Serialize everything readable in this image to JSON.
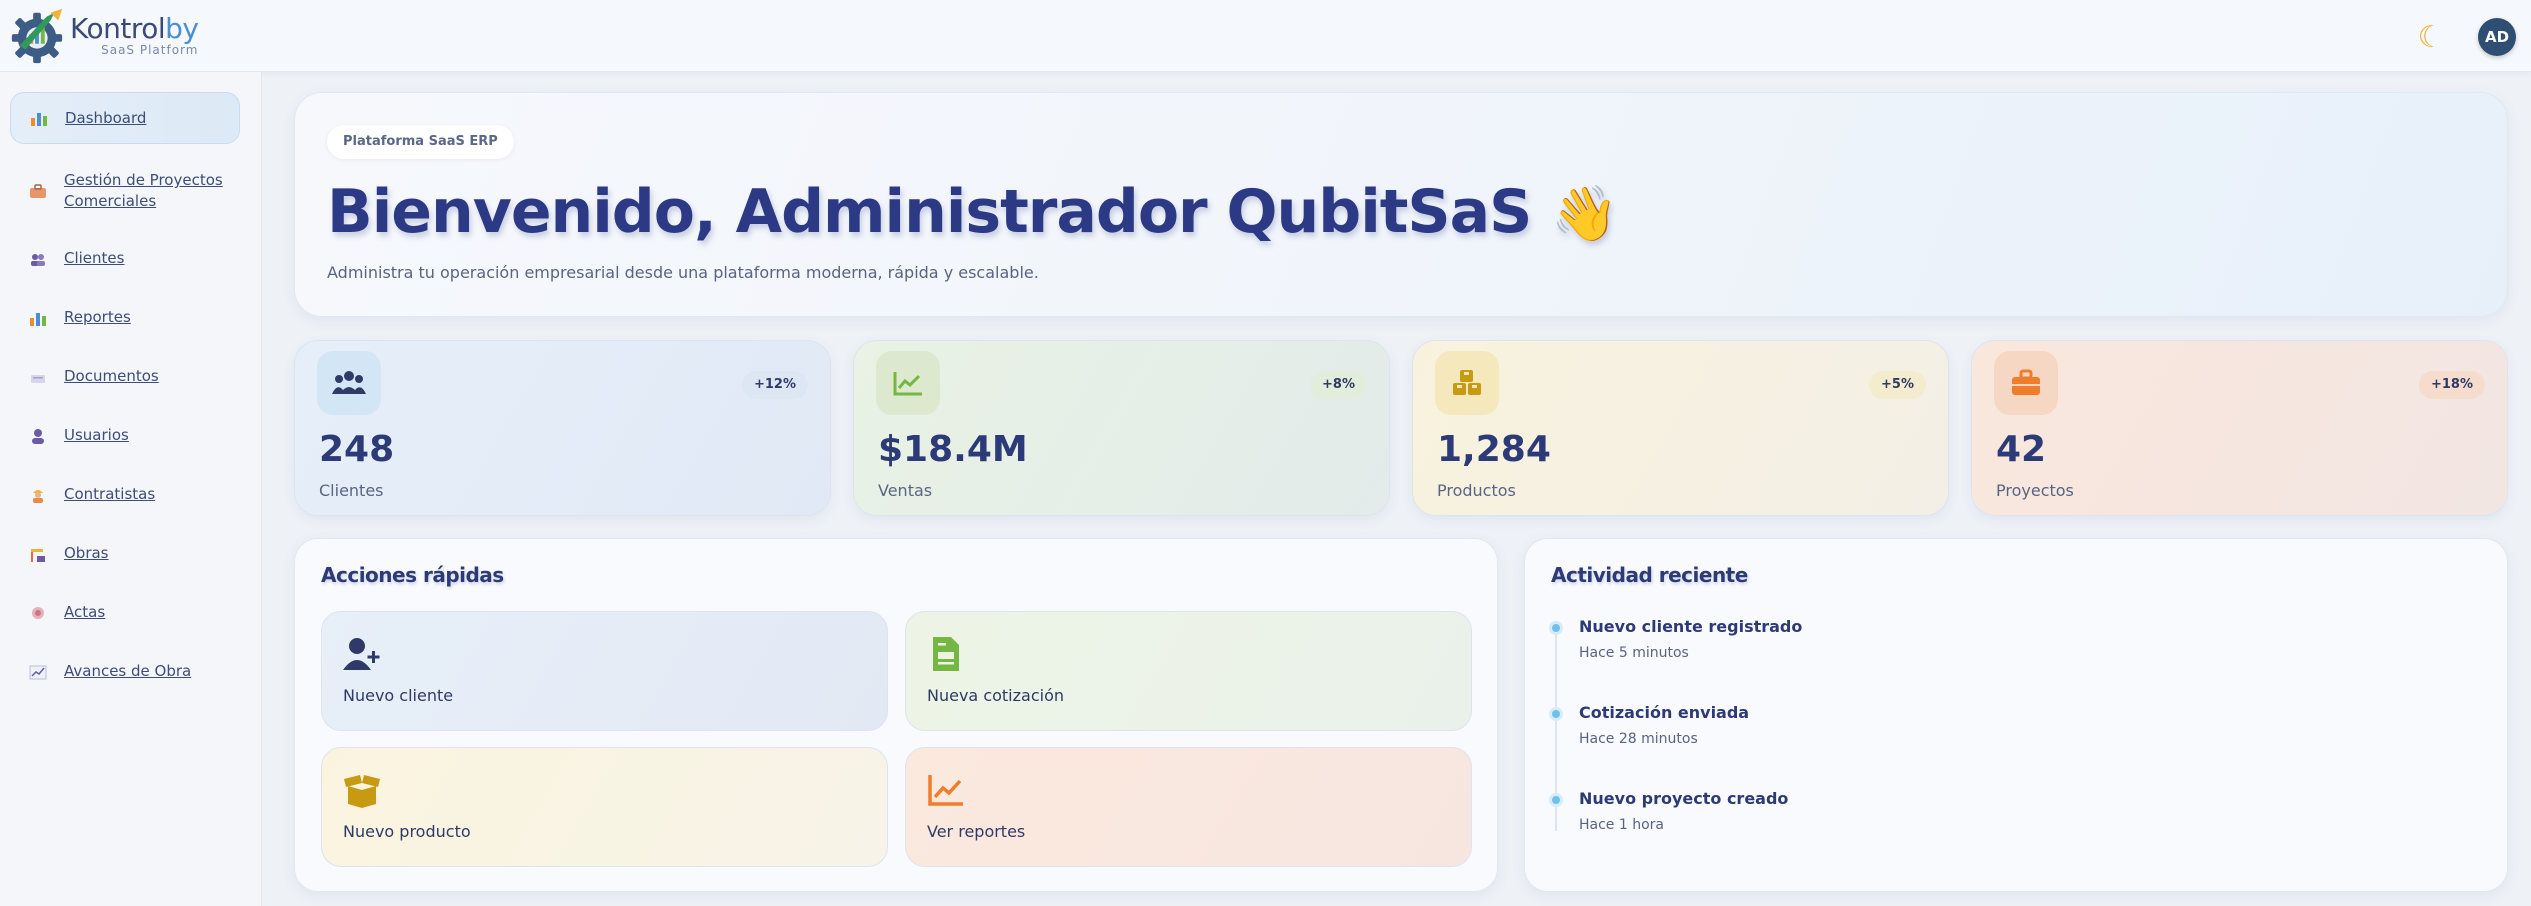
{
  "brand": {
    "name_main": "Kontrol",
    "name_accent": "by",
    "tagline": "SaaS Platform"
  },
  "header": {
    "theme_icon": "moon-icon",
    "avatar_initials": "AD"
  },
  "sidebar": {
    "items": [
      {
        "label": "Dashboard",
        "icon": "chart-bar-icon",
        "active": true
      },
      {
        "label": "Gestión de Proyectos Comerciales",
        "icon": "briefcase-icon"
      },
      {
        "label": "Clientes",
        "icon": "users-icon"
      },
      {
        "label": "Reportes",
        "icon": "chart-bar-icon"
      },
      {
        "label": "Documentos",
        "icon": "document-icon"
      },
      {
        "label": "Usuarios",
        "icon": "user-icon"
      },
      {
        "label": "Contratistas",
        "icon": "worker-icon"
      },
      {
        "label": "Obras",
        "icon": "construction-icon"
      },
      {
        "label": "Actas",
        "icon": "stamp-icon"
      },
      {
        "label": "Avances de Obra",
        "icon": "progress-chart-icon"
      }
    ]
  },
  "hero": {
    "pill": "Plataforma SaaS ERP",
    "title": "Bienvenido, Administrador QubitSaS",
    "emoji": "👋",
    "subtitle": "Administra tu operación empresarial desde una plataforma moderna, rápida y escalable."
  },
  "stats": [
    {
      "value": "248",
      "label": "Clientes",
      "badge": "+12%",
      "icon": "users-icon"
    },
    {
      "value": "$18.4M",
      "label": "Ventas",
      "badge": "+8%",
      "icon": "trend-chart-icon"
    },
    {
      "value": "1,284",
      "label": "Productos",
      "badge": "+5%",
      "icon": "boxes-icon"
    },
    {
      "value": "42",
      "label": "Proyectos",
      "badge": "+18%",
      "icon": "briefcase-icon"
    }
  ],
  "quick_actions": {
    "title": "Acciones rápidas",
    "items": [
      {
        "label": "Nuevo cliente",
        "icon": "user-plus-icon"
      },
      {
        "label": "Nueva cotización",
        "icon": "file-invoice-icon"
      },
      {
        "label": "Nuevo producto",
        "icon": "box-open-icon"
      },
      {
        "label": "Ver reportes",
        "icon": "trend-chart-icon"
      }
    ]
  },
  "activity": {
    "title": "Actividad reciente",
    "items": [
      {
        "title": "Nuevo cliente registrado",
        "time": "Hace 5 minutos"
      },
      {
        "title": "Cotización enviada",
        "time": "Hace 28 minutos"
      },
      {
        "title": "Nuevo proyecto creado",
        "time": "Hace 1 hora"
      }
    ]
  },
  "colors": {
    "primary_text": "#2c3a86",
    "accent_blue": "#4a8fd6",
    "stat_clientes_bg": "#e3edf8",
    "stat_ventas_bg": "#e9f2e4",
    "stat_productos_bg": "#f8f2dd",
    "stat_proyectos_bg": "#f9e7dc"
  }
}
